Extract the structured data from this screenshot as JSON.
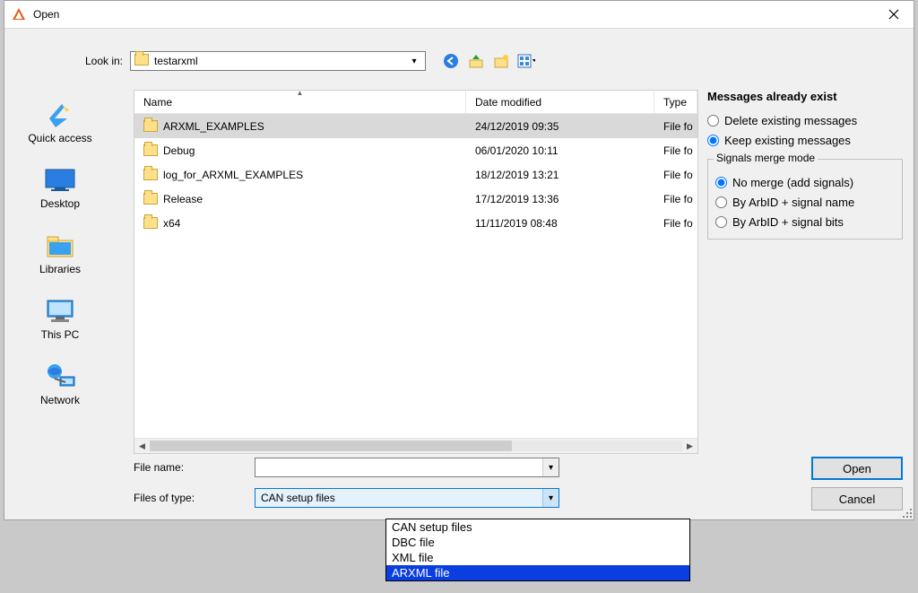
{
  "window": {
    "title": "Open"
  },
  "lookin": {
    "label": "Look in:",
    "value": "testarxml"
  },
  "places": {
    "quick_access": "Quick access",
    "desktop": "Desktop",
    "libraries": "Libraries",
    "this_pc": "This PC",
    "network": "Network"
  },
  "columns": {
    "name": "Name",
    "date": "Date modified",
    "type": "Type"
  },
  "rows": [
    {
      "name": "ARXML_EXAMPLES",
      "date": "24/12/2019 09:35",
      "type": "File fo",
      "selected": true
    },
    {
      "name": "Debug",
      "date": "06/01/2020 10:11",
      "type": "File fo",
      "selected": false
    },
    {
      "name": "log_for_ARXML_EXAMPLES",
      "date": "18/12/2019 13:21",
      "type": "File fo",
      "selected": false
    },
    {
      "name": "Release",
      "date": "17/12/2019 13:36",
      "type": "File fo",
      "selected": false
    },
    {
      "name": "x64",
      "date": "11/11/2019 08:48",
      "type": "File fo",
      "selected": false
    }
  ],
  "right": {
    "title": "Messages already exist",
    "delete": "Delete existing messages",
    "keep": "Keep existing messages",
    "merge_title": "Signals merge mode",
    "merge_none": "No merge (add signals)",
    "merge_arbid_name": "By ArbID + signal name",
    "merge_arbid_bits": "By ArbID + signal bits"
  },
  "filename": {
    "label": "File name:",
    "value": ""
  },
  "filetype": {
    "label": "Files of type:",
    "value": "CAN setup files"
  },
  "dropdown": {
    "options": [
      {
        "label": "CAN setup files",
        "hl": false
      },
      {
        "label": "DBC file",
        "hl": false
      },
      {
        "label": "XML file",
        "hl": false
      },
      {
        "label": "ARXML file",
        "hl": true
      }
    ]
  },
  "buttons": {
    "open": "Open",
    "cancel": "Cancel"
  }
}
